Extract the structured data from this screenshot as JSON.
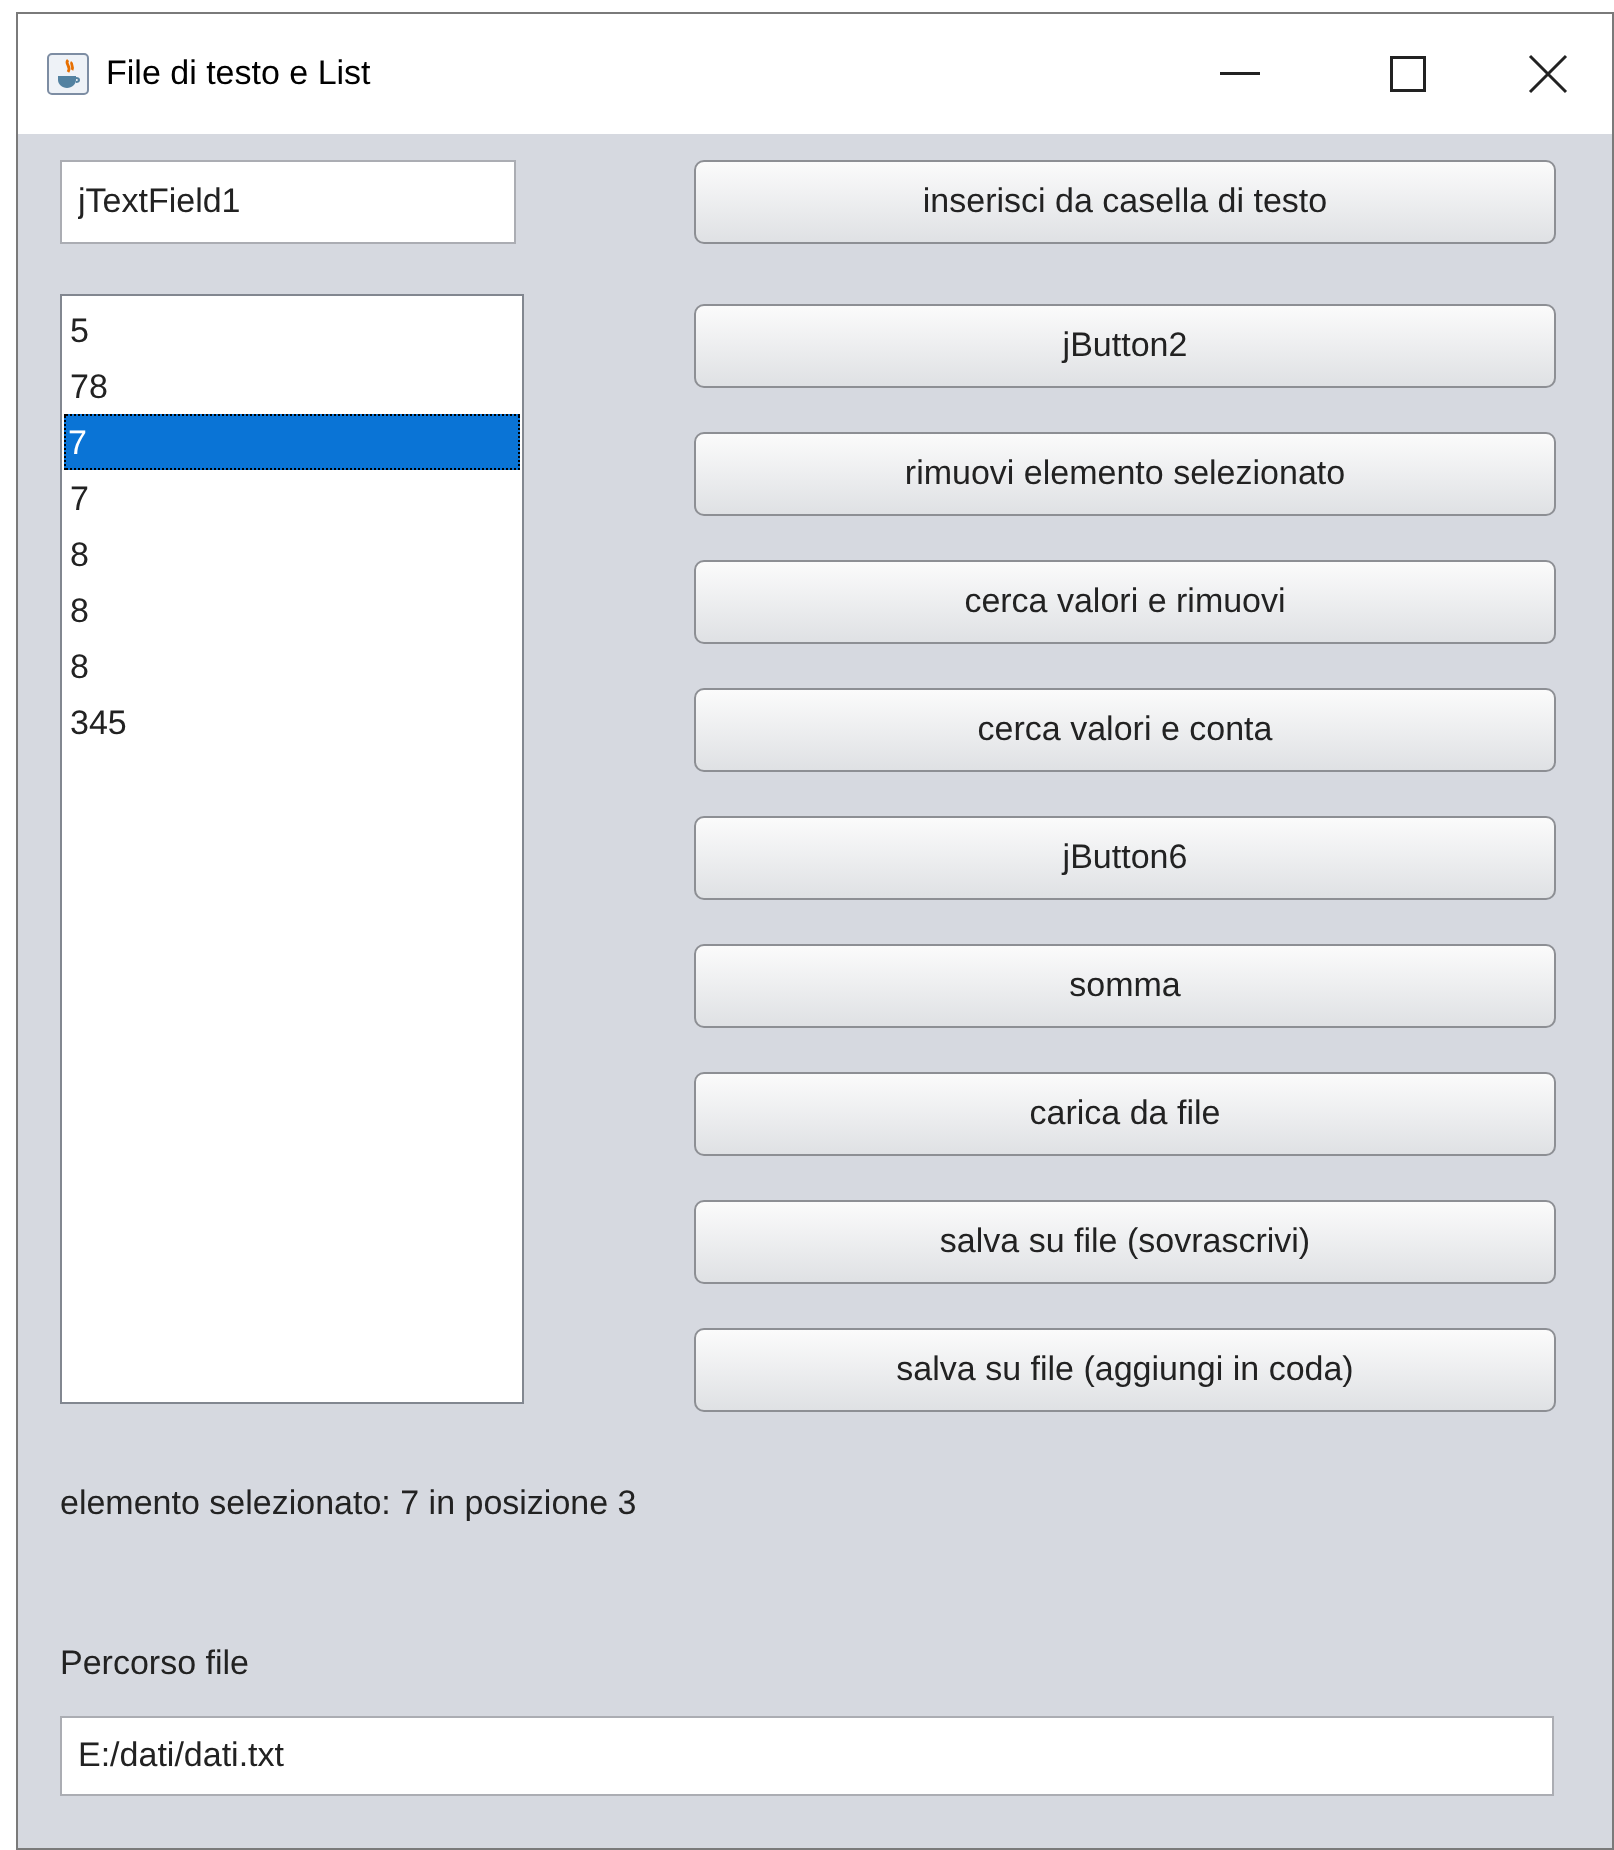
{
  "window": {
    "title": "File di testo e List"
  },
  "text_field": {
    "value": "jTextField1"
  },
  "list": {
    "items": [
      {
        "label": "5",
        "selected": false
      },
      {
        "label": "78",
        "selected": false
      },
      {
        "label": "7",
        "selected": true
      },
      {
        "label": "7",
        "selected": false
      },
      {
        "label": "8",
        "selected": false
      },
      {
        "label": "8",
        "selected": false
      },
      {
        "label": "8",
        "selected": false
      },
      {
        "label": "345",
        "selected": false
      }
    ]
  },
  "buttons": [
    "inserisci da casella di testo",
    "jButton2",
    "rimuovi elemento selezionato",
    "cerca valori e rimuovi",
    "cerca valori e conta",
    "jButton6",
    "somma",
    "carica da file",
    "salva su file (sovrascrivi)",
    "salva su file (aggiungi in coda)"
  ],
  "selection_label": "elemento selezionato: 7 in posizione 3",
  "path_label": "Percorso file",
  "path_field": {
    "value": "E:/dati/dati.txt"
  }
}
